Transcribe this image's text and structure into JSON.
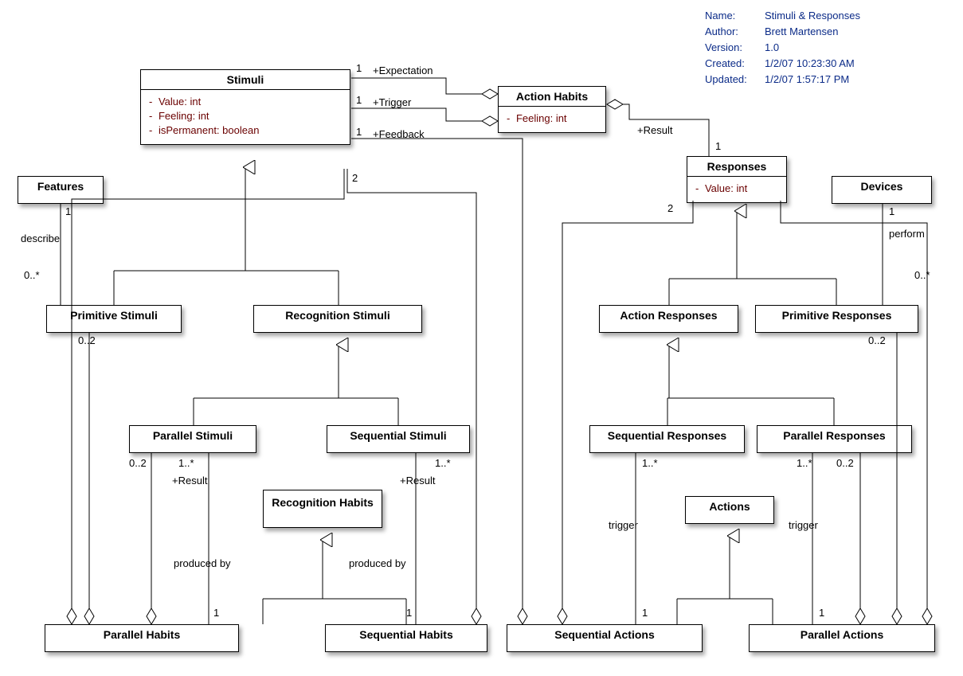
{
  "meta": {
    "name_label": "Name:",
    "name_value": "Stimuli & Responses",
    "author_label": "Author:",
    "author_value": "Brett Martensen",
    "version_label": "Version:",
    "version_value": "1.0",
    "created_label": "Created:",
    "created_value": "1/2/07 10:23:30 AM",
    "updated_label": "Updated:",
    "updated_value": "1/2/07 1:57:17 PM"
  },
  "classes": {
    "stimuli": {
      "title": "Stimuli",
      "attrs": [
        "Value: int",
        "Feeling: int",
        "isPermanent: boolean"
      ]
    },
    "action_habits": {
      "title": "Action Habits",
      "attrs": [
        "Feeling: int"
      ]
    },
    "responses": {
      "title": "Responses",
      "attrs": [
        "Value: int"
      ]
    },
    "features": {
      "title": "Features"
    },
    "devices": {
      "title": "Devices"
    },
    "primitive_stimuli": {
      "title": "Primitive Stimuli"
    },
    "recognition_stimuli": {
      "title": "Recognition Stimuli"
    },
    "action_responses": {
      "title": "Action Responses"
    },
    "primitive_responses": {
      "title": "Primitive Responses"
    },
    "parallel_stimuli": {
      "title": "Parallel Stimuli"
    },
    "sequential_stimuli": {
      "title": "Sequential Stimuli"
    },
    "recognition_habits": {
      "title": "Recognition Habits"
    },
    "actions": {
      "title": "Actions"
    },
    "sequential_responses": {
      "title": "Sequential Responses"
    },
    "parallel_responses": {
      "title": "Parallel Responses"
    },
    "parallel_habits": {
      "title": "Parallel Habits"
    },
    "sequential_habits": {
      "title": "Sequential Habits"
    },
    "sequential_actions": {
      "title": "Sequential Actions"
    },
    "parallel_actions": {
      "title": "Parallel Actions"
    }
  },
  "labels": {
    "expectation": "+Expectation",
    "trigger": "+Trigger",
    "feedback": "+Feedback",
    "result": "+Result",
    "describe": "describe",
    "perform": "perform",
    "produced_by": "produced by",
    "trigger_plain": "trigger",
    "one": "1",
    "zero_star": "0..*",
    "zero_two": "0..2",
    "one_star": "1..*",
    "two": "2"
  },
  "chart_data": {
    "type": "uml_class_diagram",
    "title": "Stimuli & Responses",
    "classes": [
      {
        "name": "Stimuli",
        "attributes": [
          {
            "name": "Value",
            "type": "int",
            "visibility": "-"
          },
          {
            "name": "Feeling",
            "type": "int",
            "visibility": "-"
          },
          {
            "name": "isPermanent",
            "type": "boolean",
            "visibility": "-"
          }
        ]
      },
      {
        "name": "Action Habits",
        "attributes": [
          {
            "name": "Feeling",
            "type": "int",
            "visibility": "-"
          }
        ]
      },
      {
        "name": "Responses",
        "attributes": [
          {
            "name": "Value",
            "type": "int",
            "visibility": "-"
          }
        ]
      },
      {
        "name": "Features"
      },
      {
        "name": "Devices"
      },
      {
        "name": "Primitive Stimuli"
      },
      {
        "name": "Recognition Stimuli"
      },
      {
        "name": "Action Responses"
      },
      {
        "name": "Primitive Responses"
      },
      {
        "name": "Parallel Stimuli"
      },
      {
        "name": "Sequential Stimuli"
      },
      {
        "name": "Recognition Habits"
      },
      {
        "name": "Sequential Responses"
      },
      {
        "name": "Parallel Responses"
      },
      {
        "name": "Actions"
      },
      {
        "name": "Parallel Habits"
      },
      {
        "name": "Sequential Habits"
      },
      {
        "name": "Sequential Actions"
      },
      {
        "name": "Parallel Actions"
      }
    ],
    "relations": [
      {
        "type": "generalization",
        "from": "Primitive Stimuli",
        "to": "Stimuli"
      },
      {
        "type": "generalization",
        "from": "Recognition Stimuli",
        "to": "Stimuli"
      },
      {
        "type": "generalization",
        "from": "Parallel Stimuli",
        "to": "Recognition Stimuli"
      },
      {
        "type": "generalization",
        "from": "Sequential Stimuli",
        "to": "Recognition Stimuli"
      },
      {
        "type": "generalization",
        "from": "Parallel Habits",
        "to": "Recognition Habits"
      },
      {
        "type": "generalization",
        "from": "Sequential Habits",
        "to": "Recognition Habits"
      },
      {
        "type": "generalization",
        "from": "Action Responses",
        "to": "Responses"
      },
      {
        "type": "generalization",
        "from": "Primitive Responses",
        "to": "Responses"
      },
      {
        "type": "generalization",
        "from": "Sequential Responses",
        "to": "Action Responses"
      },
      {
        "type": "generalization",
        "from": "Parallel Responses",
        "to": "Action Responses"
      },
      {
        "type": "generalization",
        "from": "Sequential Actions",
        "to": "Actions"
      },
      {
        "type": "generalization",
        "from": "Parallel Actions",
        "to": "Actions"
      },
      {
        "type": "aggregation",
        "from": "Stimuli",
        "to": "Action Habits",
        "role": "+Expectation",
        "from_mult": "1"
      },
      {
        "type": "aggregation",
        "from": "Stimuli",
        "to": "Action Habits",
        "role": "+Trigger",
        "from_mult": "1"
      },
      {
        "type": "aggregation",
        "from": "Responses",
        "to": "Action Habits",
        "role": "+Result",
        "from_mult": "1"
      },
      {
        "type": "aggregation",
        "from": "Stimuli",
        "to": "Sequential Actions",
        "role": "+Feedback",
        "from_mult": "1"
      },
      {
        "type": "aggregation",
        "from": "Stimuli",
        "to": "Parallel Habits",
        "from_mult": "2"
      },
      {
        "type": "aggregation",
        "from": "Stimuli",
        "to": "Sequential Habits"
      },
      {
        "type": "aggregation",
        "from": "Responses",
        "to": "Sequential Actions",
        "from_mult": "2"
      },
      {
        "type": "aggregation",
        "from": "Responses",
        "to": "Parallel Actions"
      },
      {
        "type": "aggregation",
        "from": "Primitive Stimuli",
        "to": "Parallel Habits",
        "from_mult": "0..2"
      },
      {
        "type": "aggregation",
        "from": "Primitive Responses",
        "to": "Parallel Actions",
        "from_mult": "0..2"
      },
      {
        "type": "aggregation",
        "from": "Parallel Stimuli",
        "to": "Parallel Habits",
        "from_mult": "0..2"
      },
      {
        "type": "aggregation",
        "from": "Parallel Responses",
        "to": "Parallel Actions",
        "from_mult": "0..2"
      },
      {
        "type": "association",
        "from": "Features",
        "to": "Primitive Stimuli",
        "name": "describe",
        "from_mult": "1",
        "to_mult": "0..*"
      },
      {
        "type": "association",
        "from": "Devices",
        "to": "Primitive Responses",
        "name": "perform",
        "from_mult": "1",
        "to_mult": "0..*"
      },
      {
        "type": "association",
        "from": "Parallel Stimuli",
        "to": "Parallel Habits",
        "name": "produced by",
        "role_from": "+Result",
        "from_mult": "1..*",
        "to_mult": "1"
      },
      {
        "type": "association",
        "from": "Sequential Stimuli",
        "to": "Sequential Habits",
        "name": "produced by",
        "role_from": "+Result",
        "from_mult": "1..*",
        "to_mult": "1"
      },
      {
        "type": "association",
        "from": "Sequential Responses",
        "to": "Sequential Actions",
        "name": "trigger",
        "from_mult": "1..*",
        "to_mult": "1"
      },
      {
        "type": "association",
        "from": "Parallel Responses",
        "to": "Parallel Actions",
        "name": "trigger",
        "from_mult": "1..*",
        "to_mult": "1"
      }
    ]
  }
}
